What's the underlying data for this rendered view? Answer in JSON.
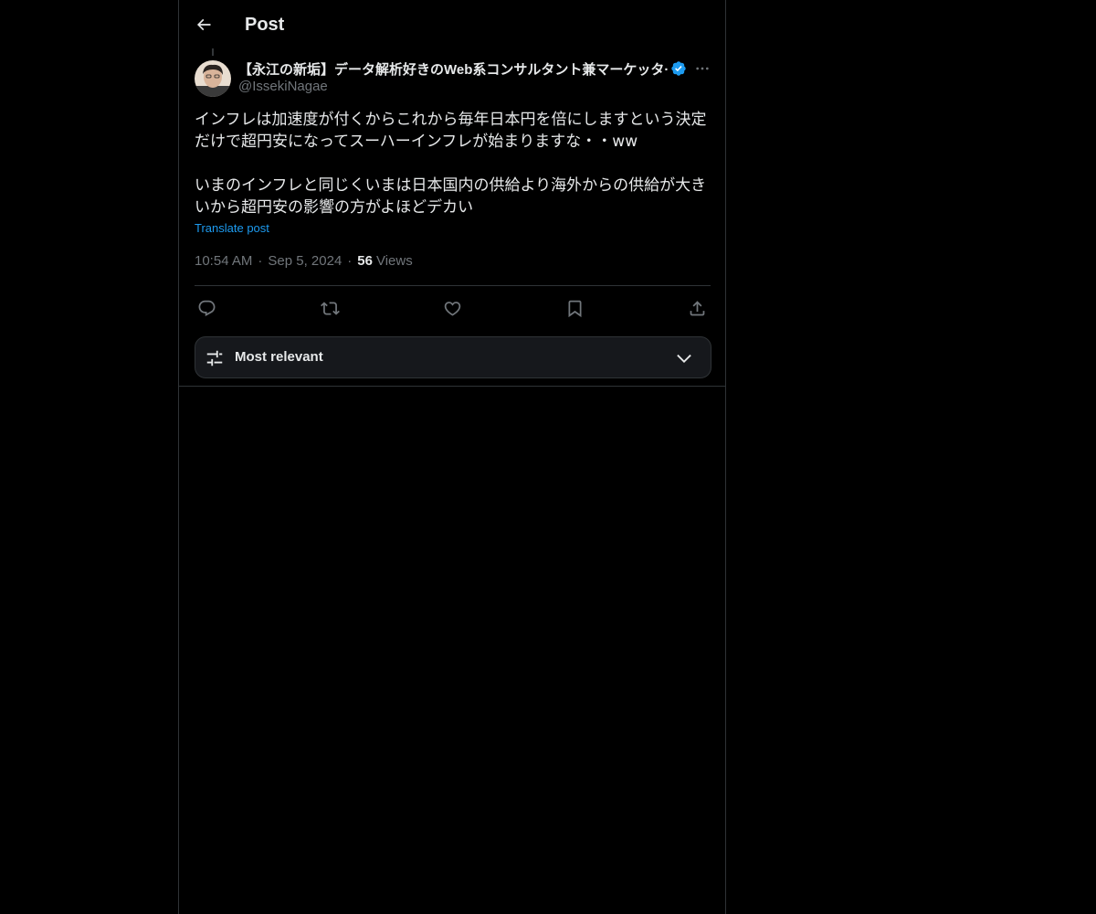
{
  "header": {
    "title": "Post"
  },
  "post": {
    "author": {
      "display_name": "【永江の新垢】データ解析好きのWeb系コンサルタント兼マーケッタ·",
      "handle": "@IssekiNagae",
      "verified": true
    },
    "text": "インフレは加速度が付くからこれから毎年日本円を倍にしますという決定だけで超円安になってスーハーインフレが始まりますな・・ww\n\nいまのインフレと同じくいまは日本国内の供給より海外からの供給が大きいから超円安の影響の方がよほどデカい",
    "translate_label": "Translate post",
    "time": "10:54 AM",
    "date": "Sep 5, 2024",
    "separator": "·",
    "views_count": "56",
    "views_label": "Views"
  },
  "actions": {
    "icons": [
      "reply-icon",
      "repost-icon",
      "like-icon",
      "bookmark-icon",
      "share-icon"
    ]
  },
  "sort": {
    "label": "Most relevant"
  },
  "colors": {
    "background": "#000000",
    "text": "#e7e9ea",
    "muted": "#71767b",
    "accent": "#1d9bf0",
    "border": "#2f3336"
  }
}
